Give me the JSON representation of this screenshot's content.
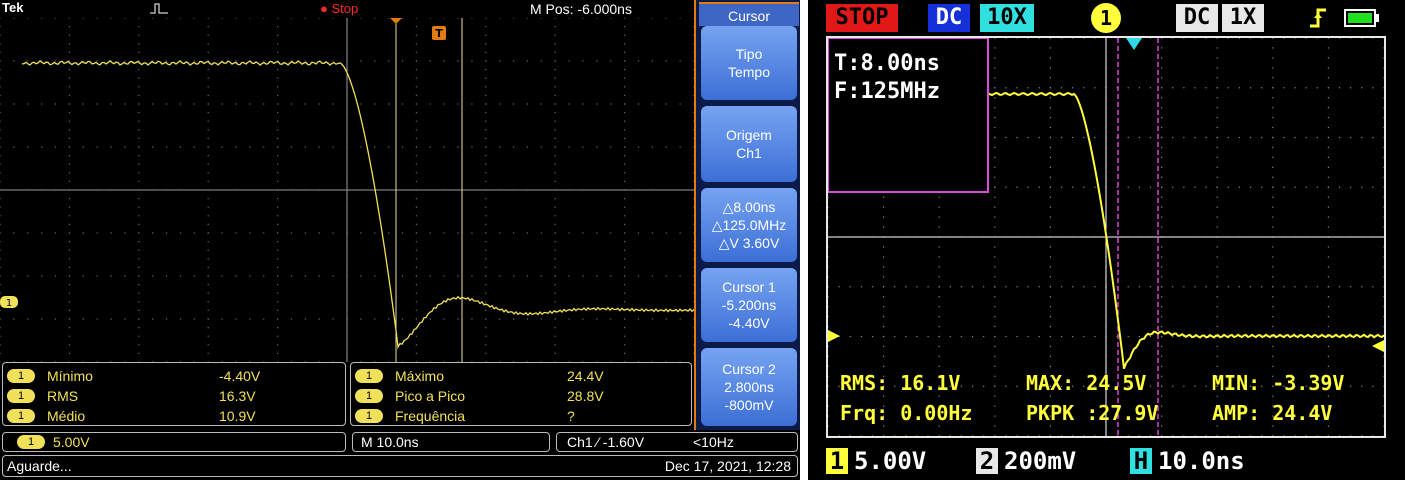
{
  "left_scope": {
    "brand": "Tek",
    "acquisition_state": "Stop",
    "m_pos": "M Pos: -6.000ns",
    "trigger_marker": "T",
    "channel_marker": "1",
    "side_menu": {
      "title": "Cursor",
      "buttons": [
        {
          "lines": [
            "Tipo",
            "Tempo"
          ]
        },
        {
          "lines": [
            "Origem",
            "Ch1"
          ]
        },
        {
          "lines": [
            "△8.00ns",
            "△125.0MHz",
            "△V 3.60V"
          ]
        },
        {
          "lines": [
            "Cursor 1",
            "-5.200ns",
            "-4.40V"
          ]
        },
        {
          "lines": [
            "Cursor 2",
            "2.800ns",
            "-800mV"
          ]
        }
      ]
    },
    "measurements": [
      {
        "channel": "1",
        "label": "Mínimo",
        "value": "-4.40V"
      },
      {
        "channel": "1",
        "label": "RMS",
        "value": "16.3V"
      },
      {
        "channel": "1",
        "label": "Médio",
        "value": "10.9V"
      },
      {
        "channel": "1",
        "label": "Máximo",
        "value": "24.4V"
      },
      {
        "channel": "1",
        "label": "Pico a Pico",
        "value": "28.8V"
      },
      {
        "channel": "1",
        "label": "Frequência",
        "value": "?"
      }
    ],
    "status": {
      "ch1_badge": "1",
      "ch1_scale": "5.00V",
      "timebase": "M 10.0ns",
      "trigger": "Ch1 ⁄ -1.60V",
      "trigger_freq": "<10Hz",
      "message": "Aguarde...",
      "datetime": "Dec 17, 2021, 12:28"
    },
    "colors": {
      "trace": "#f1e15a",
      "cursor": "#f1e15a",
      "menu_bg": "#0c1a47",
      "menu_btn": "#4a7ee0",
      "accent": "#e07c10",
      "stop": "#ff2a2a"
    }
  },
  "right_scope": {
    "top_bar": {
      "state": "STOP",
      "coupling": "DC",
      "probe": "10X",
      "channel": "1",
      "coupling2": "DC",
      "probe2": "1X",
      "trigger_icon": "rising-edge-icon",
      "battery_icon": "battery-icon"
    },
    "cursor_box": {
      "t": "T:8.00ns",
      "f": "F:125MHz"
    },
    "measurements": {
      "rms": "RMS: 16.1V",
      "max": "MAX: 24.5V",
      "min": "MIN: -3.39V",
      "frq": "Frq: 0.00Hz",
      "pkpk": "PKPK :27.9V",
      "amp": "AMP: 24.4V"
    },
    "footer": {
      "ch1_badge": "1",
      "ch1_scale": "5.00V",
      "ch2_badge": "2",
      "ch2_scale": "200mV",
      "h_badge": "H",
      "h_scale": "10.0ns"
    },
    "colors": {
      "trace": "#ffff3c",
      "cursor": "#e040e0",
      "stop_bg": "#e01818",
      "dc_bg": "#1530d8",
      "x10_bg": "#30e0e0"
    }
  }
}
